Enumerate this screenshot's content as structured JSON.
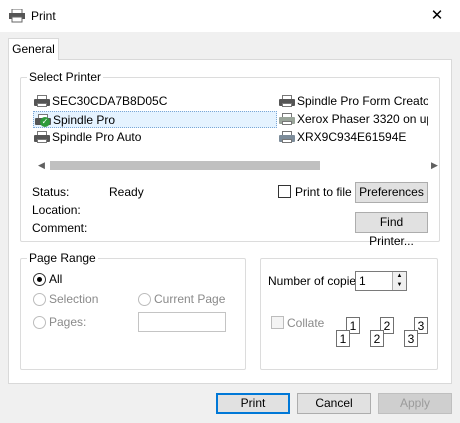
{
  "window": {
    "title": "Print"
  },
  "tabs": [
    {
      "label": "General"
    }
  ],
  "select_printer": {
    "label": "Select Printer",
    "printers": [
      {
        "name": "SEC30CDA7B8D05C"
      },
      {
        "name": "Spindle Pro Form Creato"
      },
      {
        "name": "Spindle Pro",
        "selected": true
      },
      {
        "name": "Xerox Phaser 3320 on up"
      },
      {
        "name": "Spindle Pro Auto"
      },
      {
        "name": "XRX9C934E61594E"
      }
    ]
  },
  "info": {
    "status_label": "Status:",
    "status_value": "Ready",
    "location_label": "Location:",
    "comment_label": "Comment:",
    "print_to_file_label": "Print to file",
    "preferences_label": "Preferences",
    "find_printer_label": "Find Printer..."
  },
  "page_range": {
    "label": "Page Range",
    "all_label": "All",
    "selection_label": "Selection",
    "current_page_label": "Current Page",
    "pages_label": "Pages:",
    "selected": "All"
  },
  "copies": {
    "label": "Number of copies:",
    "value": "1",
    "collate_label": "Collate",
    "collate_checked": false,
    "collate_pages": [
      "1",
      "1",
      "2",
      "2",
      "3",
      "3"
    ]
  },
  "buttons": {
    "print_label": "Print",
    "cancel_label": "Cancel",
    "apply_label": "Apply"
  }
}
